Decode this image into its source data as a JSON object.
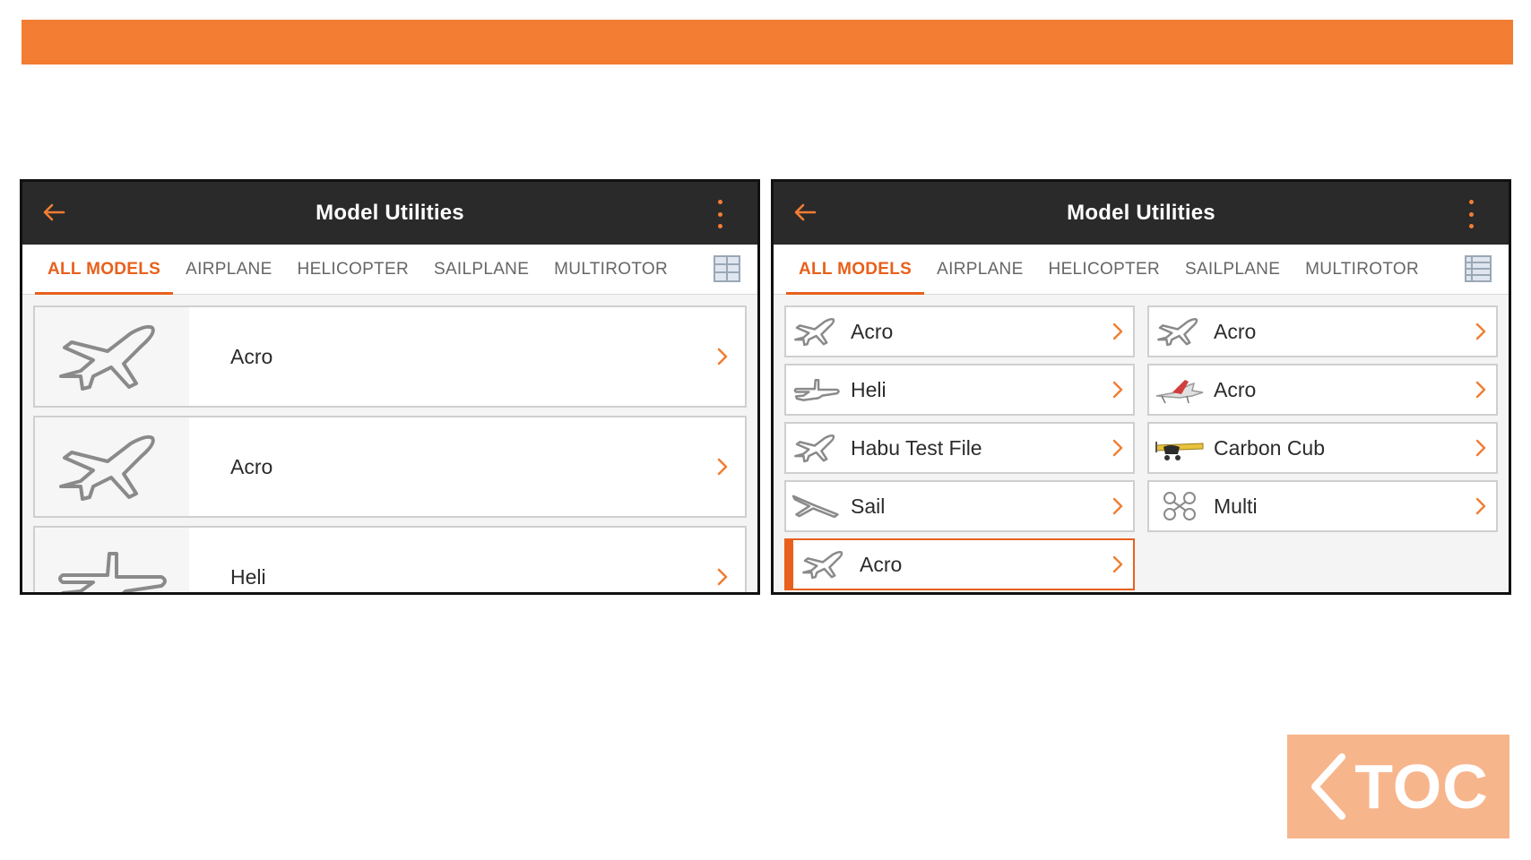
{
  "colors": {
    "accent": "#f27d33",
    "header": "#2a2a2a",
    "toc": "#f7b58c"
  },
  "left_screen": {
    "title": "Model Utilities",
    "tabs": [
      "ALL MODELS",
      "AIRPLANE",
      "HELICOPTER",
      "SAILPLANE",
      "MULTIROTOR"
    ],
    "active_tab": "ALL MODELS",
    "view_toggle_icon": "grid-view-icon",
    "items": [
      {
        "label": "Acro",
        "icon": "airplane-icon"
      },
      {
        "label": "Acro",
        "icon": "airplane-icon"
      },
      {
        "label": "Heli",
        "icon": "helicopter-icon"
      }
    ]
  },
  "right_screen": {
    "title": "Model Utilities",
    "tabs": [
      "ALL MODELS",
      "AIRPLANE",
      "HELICOPTER",
      "SAILPLANE",
      "MULTIROTOR"
    ],
    "active_tab": "ALL MODELS",
    "view_toggle_icon": "list-view-icon",
    "items": [
      {
        "label": "Acro",
        "icon": "airplane-icon"
      },
      {
        "label": "Acro",
        "icon": "airplane-icon"
      },
      {
        "label": "Heli",
        "icon": "helicopter-icon"
      },
      {
        "label": "Acro",
        "icon": "airplane-photo-icon"
      },
      {
        "label": "Habu Test File",
        "icon": "airplane-icon"
      },
      {
        "label": "Carbon Cub",
        "icon": "carbon-cub-photo-icon"
      },
      {
        "label": "Sail",
        "icon": "sailplane-icon"
      },
      {
        "label": "Multi",
        "icon": "multirotor-icon"
      },
      {
        "label": "Acro",
        "icon": "airplane-icon",
        "selected": true
      }
    ]
  },
  "toc": {
    "label": "TOC"
  }
}
